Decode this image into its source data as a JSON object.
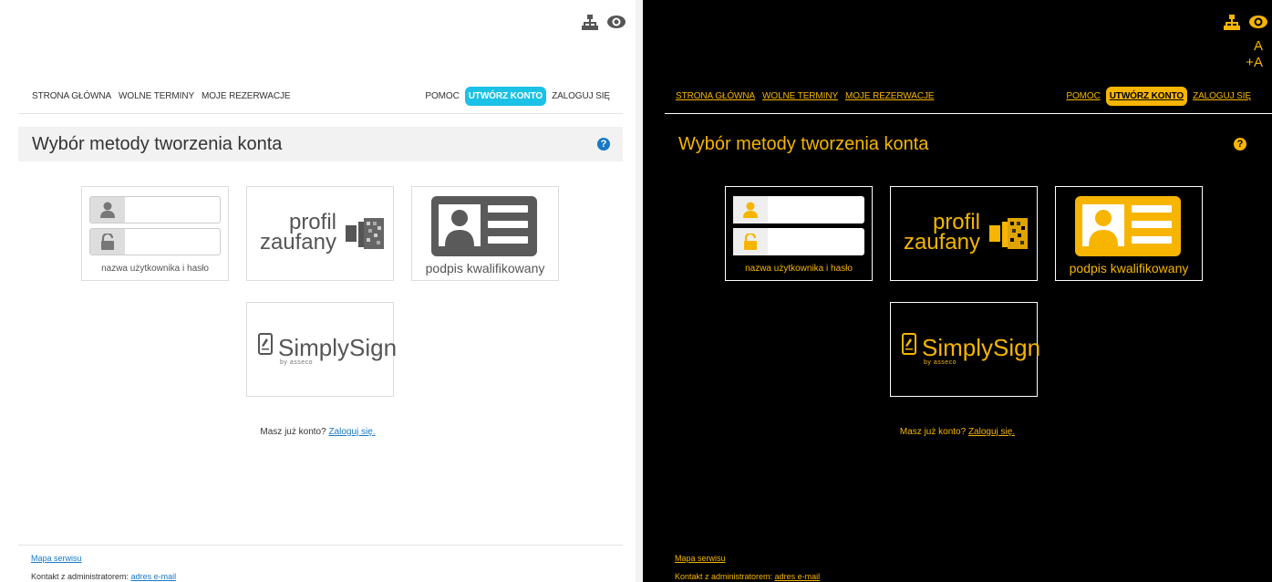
{
  "colors": {
    "accent_light": "#1cc1e6",
    "accent_dark": "#f7b500",
    "link_light": "#1778c7"
  },
  "icons": {
    "sitemap": "sitemap-icon",
    "contrast": "eye-icon",
    "help": "help-icon",
    "user": "user-icon",
    "lock": "lock-icon",
    "id_card": "id-card-icon",
    "phone": "phone-icon"
  },
  "font_controls": {
    "normal": "A",
    "larger": "+A"
  },
  "nav": {
    "home": "STRONA GŁÓWNA",
    "free_slots": "WOLNE TERMINY",
    "my_reservations": "MOJE REZERWACJE",
    "help": "POMOC",
    "create_account": "UTWÓRZ KONTO",
    "login": "ZALOGUJ SIĘ"
  },
  "page": {
    "title": "Wybór metody tworzenia konta",
    "help_glyph": "?"
  },
  "methods": {
    "username_password": "nazwa użytkownika i hasło",
    "profil_line1": "profil",
    "profil_line2": "zaufany",
    "qualified_signature": "podpis kwalifikowany",
    "simplysign": "SimplySign",
    "simplysign_by": "by asseco"
  },
  "login_prompt": {
    "text": "Masz już konto?",
    "link": "Zaloguj się."
  },
  "footer": {
    "sitemap": "Mapa serwisu",
    "contact_text": "Kontakt z administratorem:",
    "contact_link": "adres e-mail"
  }
}
